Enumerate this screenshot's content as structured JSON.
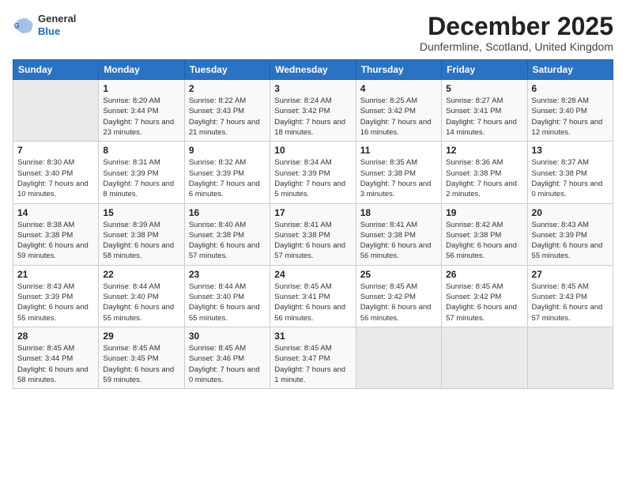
{
  "logo": {
    "general": "General",
    "blue": "Blue"
  },
  "title": "December 2025",
  "location": "Dunfermline, Scotland, United Kingdom",
  "days_header": [
    "Sunday",
    "Monday",
    "Tuesday",
    "Wednesday",
    "Thursday",
    "Friday",
    "Saturday"
  ],
  "weeks": [
    [
      {
        "day": "",
        "empty": true
      },
      {
        "day": "1",
        "sunrise": "Sunrise: 8:20 AM",
        "sunset": "Sunset: 3:44 PM",
        "daylight": "Daylight: 7 hours and 23 minutes."
      },
      {
        "day": "2",
        "sunrise": "Sunrise: 8:22 AM",
        "sunset": "Sunset: 3:43 PM",
        "daylight": "Daylight: 7 hours and 21 minutes."
      },
      {
        "day": "3",
        "sunrise": "Sunrise: 8:24 AM",
        "sunset": "Sunset: 3:42 PM",
        "daylight": "Daylight: 7 hours and 18 minutes."
      },
      {
        "day": "4",
        "sunrise": "Sunrise: 8:25 AM",
        "sunset": "Sunset: 3:42 PM",
        "daylight": "Daylight: 7 hours and 16 minutes."
      },
      {
        "day": "5",
        "sunrise": "Sunrise: 8:27 AM",
        "sunset": "Sunset: 3:41 PM",
        "daylight": "Daylight: 7 hours and 14 minutes."
      },
      {
        "day": "6",
        "sunrise": "Sunrise: 8:28 AM",
        "sunset": "Sunset: 3:40 PM",
        "daylight": "Daylight: 7 hours and 12 minutes."
      }
    ],
    [
      {
        "day": "7",
        "sunrise": "Sunrise: 8:30 AM",
        "sunset": "Sunset: 3:40 PM",
        "daylight": "Daylight: 7 hours and 10 minutes."
      },
      {
        "day": "8",
        "sunrise": "Sunrise: 8:31 AM",
        "sunset": "Sunset: 3:39 PM",
        "daylight": "Daylight: 7 hours and 8 minutes."
      },
      {
        "day": "9",
        "sunrise": "Sunrise: 8:32 AM",
        "sunset": "Sunset: 3:39 PM",
        "daylight": "Daylight: 7 hours and 6 minutes."
      },
      {
        "day": "10",
        "sunrise": "Sunrise: 8:34 AM",
        "sunset": "Sunset: 3:39 PM",
        "daylight": "Daylight: 7 hours and 5 minutes."
      },
      {
        "day": "11",
        "sunrise": "Sunrise: 8:35 AM",
        "sunset": "Sunset: 3:38 PM",
        "daylight": "Daylight: 7 hours and 3 minutes."
      },
      {
        "day": "12",
        "sunrise": "Sunrise: 8:36 AM",
        "sunset": "Sunset: 3:38 PM",
        "daylight": "Daylight: 7 hours and 2 minutes."
      },
      {
        "day": "13",
        "sunrise": "Sunrise: 8:37 AM",
        "sunset": "Sunset: 3:38 PM",
        "daylight": "Daylight: 7 hours and 0 minutes."
      }
    ],
    [
      {
        "day": "14",
        "sunrise": "Sunrise: 8:38 AM",
        "sunset": "Sunset: 3:38 PM",
        "daylight": "Daylight: 6 hours and 59 minutes."
      },
      {
        "day": "15",
        "sunrise": "Sunrise: 8:39 AM",
        "sunset": "Sunset: 3:38 PM",
        "daylight": "Daylight: 6 hours and 58 minutes."
      },
      {
        "day": "16",
        "sunrise": "Sunrise: 8:40 AM",
        "sunset": "Sunset: 3:38 PM",
        "daylight": "Daylight: 6 hours and 57 minutes."
      },
      {
        "day": "17",
        "sunrise": "Sunrise: 8:41 AM",
        "sunset": "Sunset: 3:38 PM",
        "daylight": "Daylight: 6 hours and 57 minutes."
      },
      {
        "day": "18",
        "sunrise": "Sunrise: 8:41 AM",
        "sunset": "Sunset: 3:38 PM",
        "daylight": "Daylight: 6 hours and 56 minutes."
      },
      {
        "day": "19",
        "sunrise": "Sunrise: 8:42 AM",
        "sunset": "Sunset: 3:38 PM",
        "daylight": "Daylight: 6 hours and 56 minutes."
      },
      {
        "day": "20",
        "sunrise": "Sunrise: 8:43 AM",
        "sunset": "Sunset: 3:39 PM",
        "daylight": "Daylight: 6 hours and 55 minutes."
      }
    ],
    [
      {
        "day": "21",
        "sunrise": "Sunrise: 8:43 AM",
        "sunset": "Sunset: 3:39 PM",
        "daylight": "Daylight: 6 hours and 55 minutes."
      },
      {
        "day": "22",
        "sunrise": "Sunrise: 8:44 AM",
        "sunset": "Sunset: 3:40 PM",
        "daylight": "Daylight: 6 hours and 55 minutes."
      },
      {
        "day": "23",
        "sunrise": "Sunrise: 8:44 AM",
        "sunset": "Sunset: 3:40 PM",
        "daylight": "Daylight: 6 hours and 55 minutes."
      },
      {
        "day": "24",
        "sunrise": "Sunrise: 8:45 AM",
        "sunset": "Sunset: 3:41 PM",
        "daylight": "Daylight: 6 hours and 56 minutes."
      },
      {
        "day": "25",
        "sunrise": "Sunrise: 8:45 AM",
        "sunset": "Sunset: 3:42 PM",
        "daylight": "Daylight: 6 hours and 56 minutes."
      },
      {
        "day": "26",
        "sunrise": "Sunrise: 8:45 AM",
        "sunset": "Sunset: 3:42 PM",
        "daylight": "Daylight: 6 hours and 57 minutes."
      },
      {
        "day": "27",
        "sunrise": "Sunrise: 8:45 AM",
        "sunset": "Sunset: 3:43 PM",
        "daylight": "Daylight: 6 hours and 57 minutes."
      }
    ],
    [
      {
        "day": "28",
        "sunrise": "Sunrise: 8:45 AM",
        "sunset": "Sunset: 3:44 PM",
        "daylight": "Daylight: 6 hours and 58 minutes."
      },
      {
        "day": "29",
        "sunrise": "Sunrise: 8:45 AM",
        "sunset": "Sunset: 3:45 PM",
        "daylight": "Daylight: 6 hours and 59 minutes."
      },
      {
        "day": "30",
        "sunrise": "Sunrise: 8:45 AM",
        "sunset": "Sunset: 3:46 PM",
        "daylight": "Daylight: 7 hours and 0 minutes."
      },
      {
        "day": "31",
        "sunrise": "Sunrise: 8:45 AM",
        "sunset": "Sunset: 3:47 PM",
        "daylight": "Daylight: 7 hours and 1 minute."
      },
      {
        "day": "",
        "empty": true
      },
      {
        "day": "",
        "empty": true
      },
      {
        "day": "",
        "empty": true
      }
    ]
  ]
}
